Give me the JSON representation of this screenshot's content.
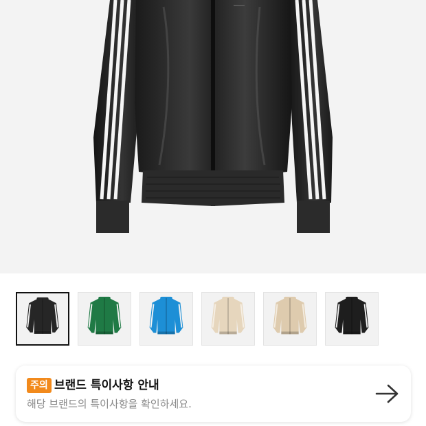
{
  "hero": {
    "image_icon": "jacket-photo-icon"
  },
  "thumbnails": [
    {
      "name": "thumb-black-leather",
      "icon": "jacket-thumb-icon",
      "body_color": "#262626",
      "stripe_color": "#f2f2f2",
      "selected": true
    },
    {
      "name": "thumb-green",
      "icon": "jacket-thumb-icon",
      "body_color": "#1f7a45",
      "stripe_color": "#f2f2f2",
      "selected": false
    },
    {
      "name": "thumb-blue",
      "icon": "jacket-thumb-icon",
      "body_color": "#1d8fd6",
      "stripe_color": "#f2f2f2",
      "selected": false
    },
    {
      "name": "thumb-beige-1",
      "icon": "jacket-thumb-icon",
      "body_color": "#e6d6bd",
      "stripe_color": "#f6efe4",
      "selected": false
    },
    {
      "name": "thumb-beige-2",
      "icon": "jacket-thumb-icon",
      "body_color": "#decbae",
      "stripe_color": "#f4ecdf",
      "selected": false
    },
    {
      "name": "thumb-black-2",
      "icon": "jacket-thumb-icon",
      "body_color": "#1e1e1e",
      "stripe_color": "#eeeeee",
      "selected": false
    }
  ],
  "notice": {
    "badge": "주의",
    "title": "브랜드 특이사항 안내",
    "subtitle": "해당 브랜드의 특이사항을 확인하세요.",
    "arrow_icon": "arrow-right-icon",
    "badge_color": "#f28a1c"
  }
}
